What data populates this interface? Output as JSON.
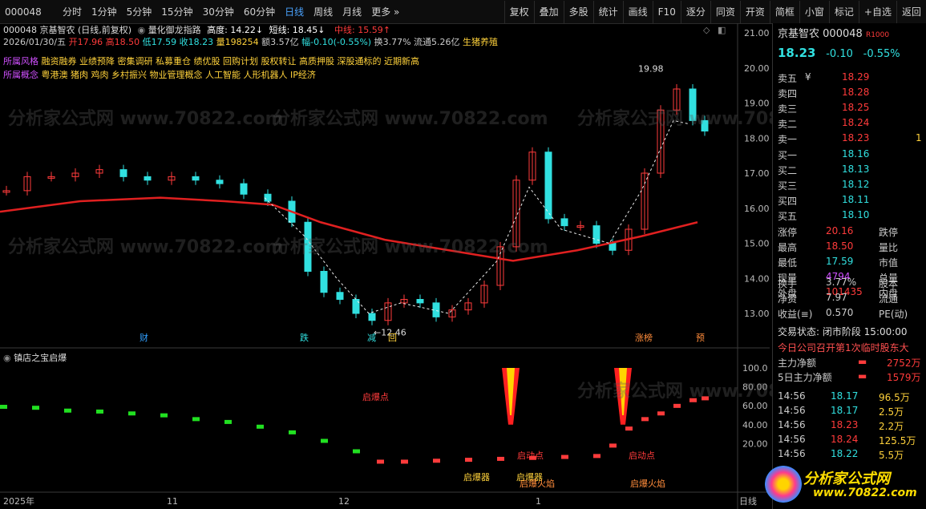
{
  "toolbar": {
    "stock_code": "000048",
    "periods": [
      "分时",
      "1分钟",
      "5分钟",
      "15分钟",
      "30分钟",
      "60分钟",
      "日线",
      "周线",
      "月线",
      "更多 »"
    ],
    "active_period": "日线",
    "buttons": [
      "复权",
      "叠加",
      "多股",
      "统计",
      "画线",
      "F10",
      "逐分",
      "同资",
      "开资",
      "简框",
      "小窗",
      "标记",
      "+自选",
      "返回"
    ]
  },
  "chart_header": {
    "title": "000048 京基智农 (日线,前复权)",
    "indicator": "量化御龙指路",
    "high_label": "高度: 14.22↓",
    "short_label": "短线: 18.45↓",
    "mid_label": "中线: 15.59↑",
    "date": "2026/01/30/五",
    "open": "开17.96",
    "high": "高18.50",
    "low": "低17.59",
    "close": "收18.23",
    "volume": "量198254",
    "amount": "额3.57亿",
    "change": "幅-0.10(-0.55%)",
    "turnover": "换3.77%",
    "float": "流通5.26亿",
    "tag": "生猪养殖"
  },
  "styles_line": {
    "label": "所属风格",
    "items": "融资融券 业绩预降 密集调研 私募重仓 绩优股 回购计划 股权转让 高质押股 深股通标的 近期新高"
  },
  "concept_line": {
    "label": "所属概念",
    "items": "粤港澳 猪肉 鸡肉 乡村振兴 物业管理概念 人工智能 人形机器人 IP经济"
  },
  "main_yaxis": [
    "21.00",
    "20.00",
    "19.00",
    "18.00",
    "17.00",
    "16.00",
    "15.00",
    "14.00",
    "13.00"
  ],
  "sub_yaxis": [
    "100.0",
    "80.00",
    "60.00",
    "40.00",
    "20.00"
  ],
  "annotations": {
    "high_mark": "19.98",
    "low_mark": "12.46",
    "event_labels": [
      "财",
      "跌",
      "减",
      "回",
      "涨榜",
      "预"
    ]
  },
  "sub_chart": {
    "title": "镇店之宝启爆",
    "labels": [
      "启爆点",
      "启爆器",
      "启爆器",
      "启动点",
      "启爆火焰",
      "启动点",
      "启爆火焰"
    ]
  },
  "xaxis": [
    "2025年",
    "11",
    "12",
    "1",
    "日线"
  ],
  "chart_data": {
    "type": "candlestick",
    "series": [
      {
        "name": "高度",
        "value": 14.22
      },
      {
        "name": "短线",
        "value": 18.45
      },
      {
        "name": "中线",
        "value": 15.59
      }
    ],
    "last_bar": {
      "date": "2026/01/30",
      "open": 17.96,
      "high": 18.5,
      "low": 17.59,
      "close": 18.23
    },
    "y_range": [
      12.5,
      21.2
    ],
    "high": 19.98,
    "low": 12.46,
    "ma_line_color": "#e02020",
    "up_color": "#ff3b3b",
    "down_color": "#31e0e0"
  },
  "quote": {
    "name": "京基智农",
    "code": "000048",
    "badge": "R1000",
    "price": "18.23",
    "chg": "-0.10",
    "pct": "-0.55%",
    "asks": [
      [
        "卖五",
        "¥",
        "18.29",
        ""
      ],
      [
        "卖四",
        "",
        "18.28",
        ""
      ],
      [
        "卖三",
        "",
        "18.25",
        ""
      ],
      [
        "卖二",
        "",
        "18.24",
        ""
      ],
      [
        "卖一",
        "",
        "18.23",
        "1"
      ]
    ],
    "bids": [
      [
        "买一",
        "18.16"
      ],
      [
        "买二",
        "18.13"
      ],
      [
        "买三",
        "18.12"
      ],
      [
        "买四",
        "18.11"
      ],
      [
        "买五",
        "18.10"
      ]
    ],
    "stats": [
      [
        "涨停",
        "20.16",
        "跌停"
      ],
      [
        "最高",
        "18.50",
        "量比"
      ],
      [
        "最低",
        "17.59",
        "市值"
      ],
      [
        "现量",
        "4794",
        "总量"
      ],
      [
        "外盘",
        "101435",
        "内盘"
      ]
    ],
    "stats2": [
      [
        "换手",
        "3.77%",
        "股本"
      ],
      [
        "净资",
        "7.97",
        "流通"
      ],
      [
        "收益(≡)",
        "0.570",
        "PE(动)"
      ]
    ],
    "trade_state": "交易状态: 闭市阶段 15:00:00",
    "notice": "今日公司召开第1次临时股东大",
    "flows": [
      [
        "主力净额",
        "2752万"
      ],
      [
        "5日主力净额",
        "1579万"
      ]
    ],
    "ticks": [
      [
        "14:56",
        "18.17",
        "96.5万"
      ],
      [
        "14:56",
        "18.17",
        "2.5万"
      ],
      [
        "14:56",
        "18.23",
        "2.2万"
      ],
      [
        "14:56",
        "18.24",
        "125.5万"
      ],
      [
        "14:56",
        "18.22",
        "5.5万"
      ]
    ],
    "logo": "分析家公式网",
    "logo_url": "www.70822.com"
  },
  "watermark": "分析家公式网 www.70822.com"
}
